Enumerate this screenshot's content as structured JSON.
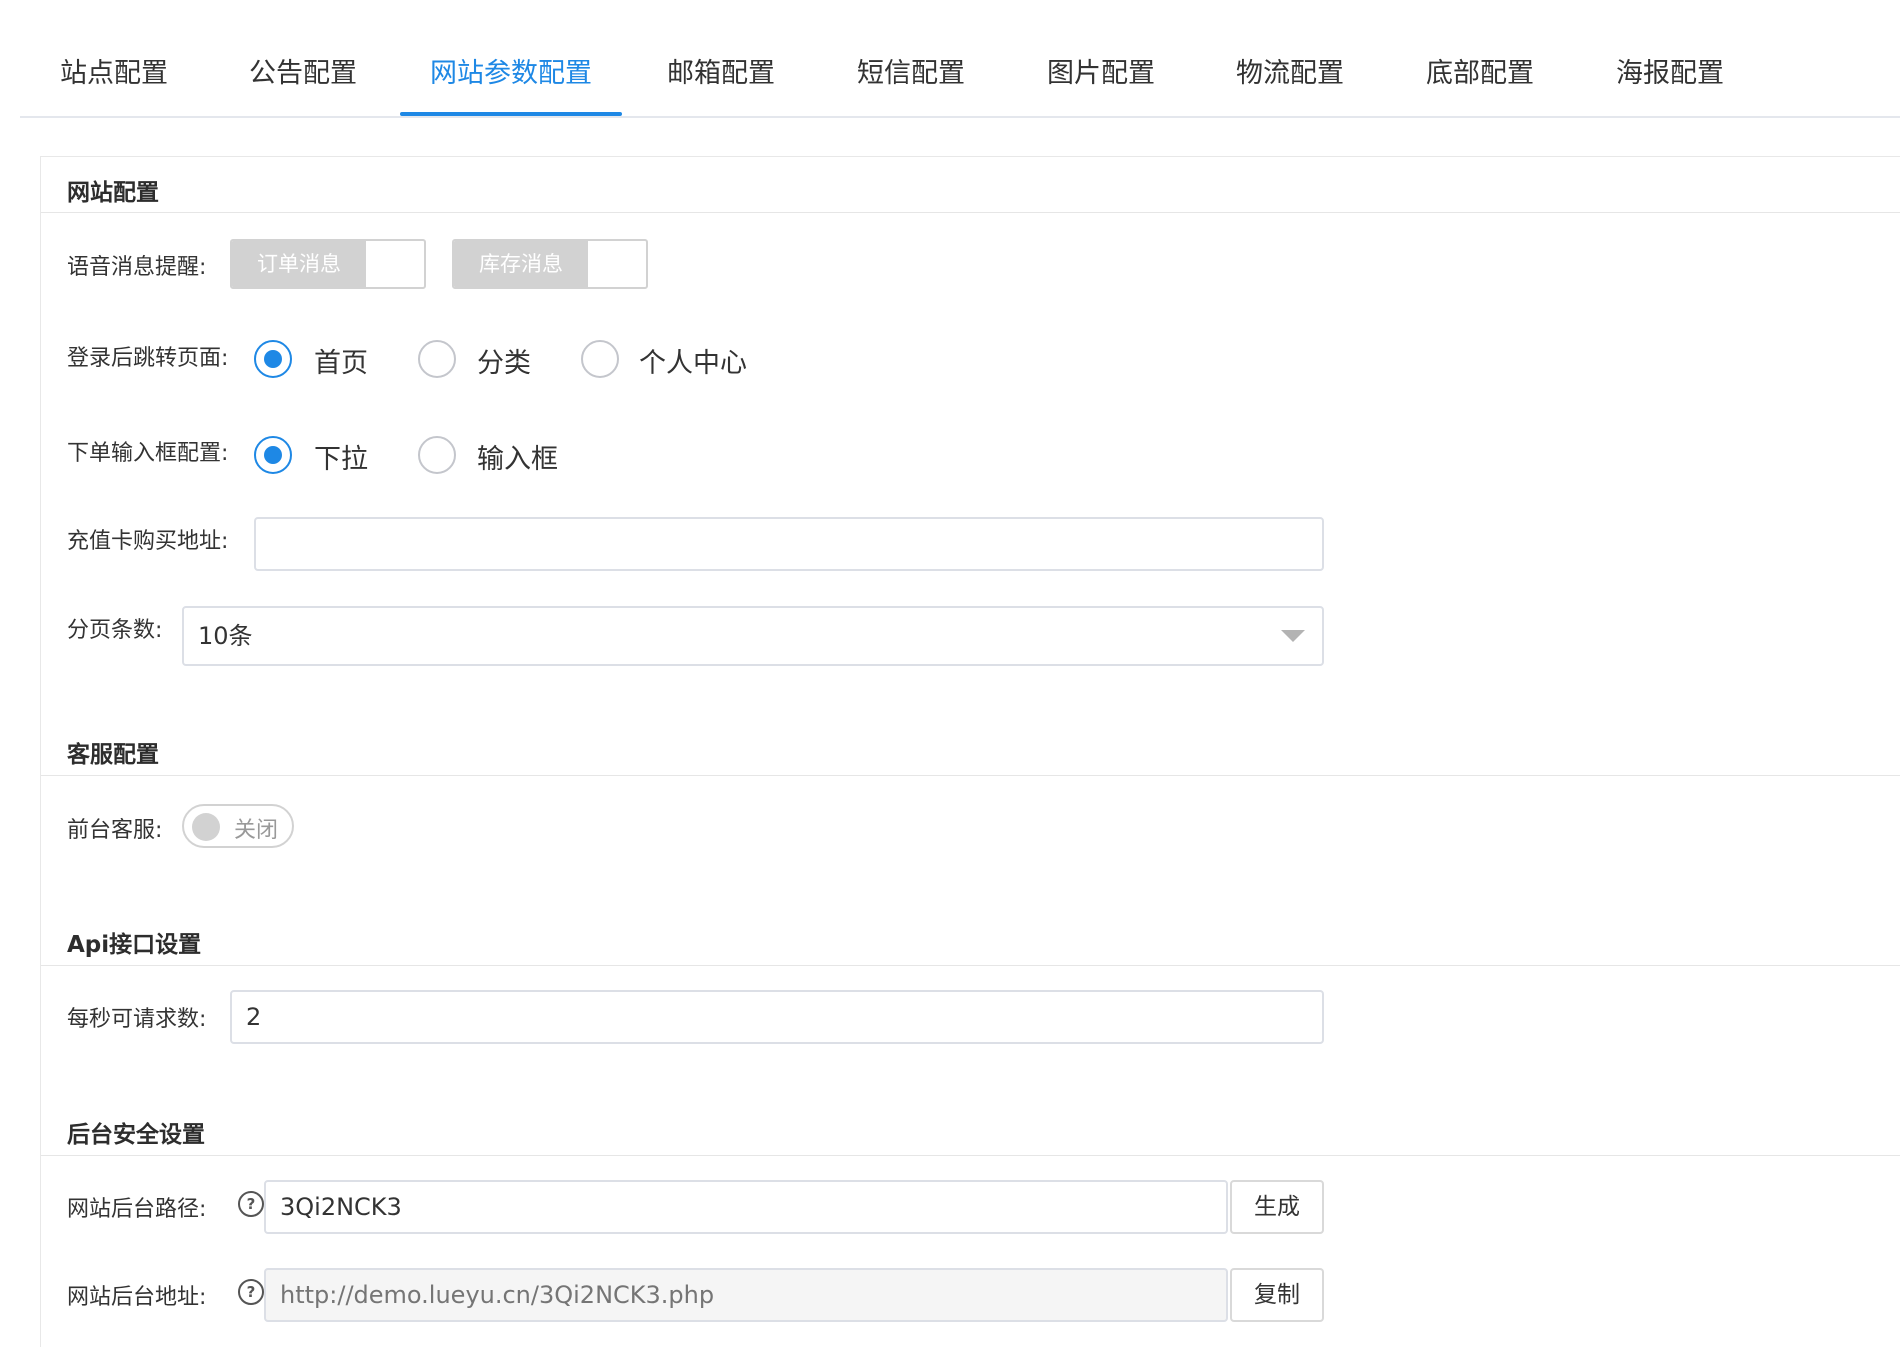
{
  "tabs": [
    {
      "label": "站点配置"
    },
    {
      "label": "公告配置"
    },
    {
      "label": "网站参数配置",
      "active": true
    },
    {
      "label": "邮箱配置"
    },
    {
      "label": "短信配置"
    },
    {
      "label": "图片配置"
    },
    {
      "label": "物流配置"
    },
    {
      "label": "底部配置"
    },
    {
      "label": "海报配置"
    }
  ],
  "site_config": {
    "title": "网站配置",
    "voice_alert": {
      "label": "语音消息提醒:",
      "order_msg": "订单消息",
      "stock_msg": "库存消息"
    },
    "login_redirect": {
      "label": "登录后跳转页面:",
      "options": [
        "首页",
        "分类",
        "个人中心"
      ],
      "selected": "首页"
    },
    "order_input": {
      "label": "下单输入框配置:",
      "options": [
        "下拉",
        "输入框"
      ],
      "selected": "下拉"
    },
    "recharge_url": {
      "label": "充值卡购买地址:",
      "value": ""
    },
    "page_size": {
      "label": "分页条数:",
      "value": "10条"
    }
  },
  "customer_service": {
    "title": "客服配置",
    "frontend": {
      "label": "前台客服:",
      "state_text": "关闭"
    }
  },
  "api_settings": {
    "title": "Api接口设置",
    "rps": {
      "label": "每秒可请求数:",
      "value": "2"
    }
  },
  "security": {
    "title": "后台安全设置",
    "admin_path": {
      "label": "网站后台路径:",
      "value": "3Qi2NCK3",
      "button": "生成"
    },
    "admin_url": {
      "label": "网站后台地址:",
      "placeholder": "http://demo.lueyu.cn/3Qi2NCK3.php",
      "button": "复制"
    }
  },
  "colors": {
    "accent": "#1e88e5",
    "border": "#dcdfe6",
    "disabled_bg": "#f5f5f5"
  }
}
